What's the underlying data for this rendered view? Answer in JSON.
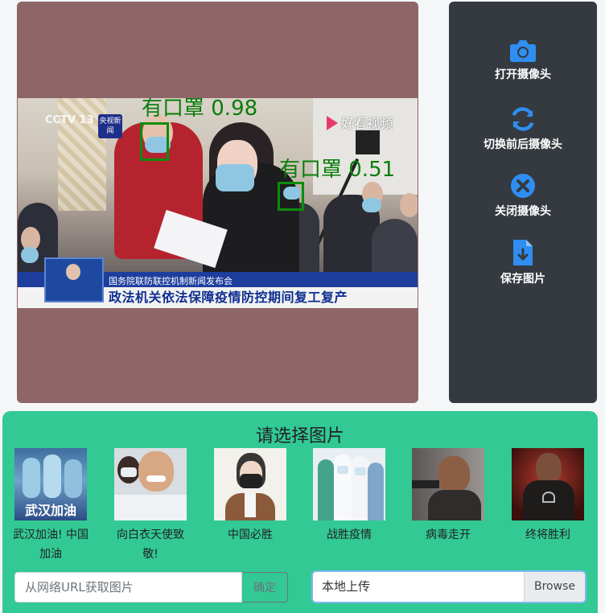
{
  "viewer": {
    "detections": [
      {
        "label": "有口罩 0.98"
      },
      {
        "label": "有口罩 0.51"
      }
    ],
    "broadcast": {
      "channel": "CCTV 13",
      "channel_logo": "央视新闻",
      "live_logo": "好看视频",
      "lower_third_sub": "国务院联防联控机制新闻发布会",
      "lower_third_main": "政法机关依法保障疫情防控期间复工复产"
    }
  },
  "sidebar": {
    "items": [
      {
        "label": "打开摄像头",
        "icon": "camera-icon"
      },
      {
        "label": "切换前后摄像头",
        "icon": "sync-icon"
      },
      {
        "label": "关闭摄像头",
        "icon": "close-circle-icon"
      },
      {
        "label": "保存图片",
        "icon": "file-download-icon"
      }
    ],
    "icon_color": "#2f8ef0"
  },
  "panel": {
    "title": "请选择图片",
    "thumbnails": [
      {
        "caption": "武汉加油! 中国加油",
        "overlay_text": "武汉加油"
      },
      {
        "caption": "向白衣天使致敬!"
      },
      {
        "caption": "中国必胜"
      },
      {
        "caption": "战胜疫情"
      },
      {
        "caption": "病毒走开"
      },
      {
        "caption": "终将胜利"
      }
    ],
    "url_input": {
      "placeholder": "从网络URL获取图片",
      "button": "确定"
    },
    "file_input": {
      "label": "本地上传",
      "button": "Browse"
    }
  },
  "colors": {
    "panel_bg": "#32c994",
    "sidebar_bg": "#343a40",
    "viewer_bg": "#8f6667",
    "detection": "#0c8c0c"
  }
}
